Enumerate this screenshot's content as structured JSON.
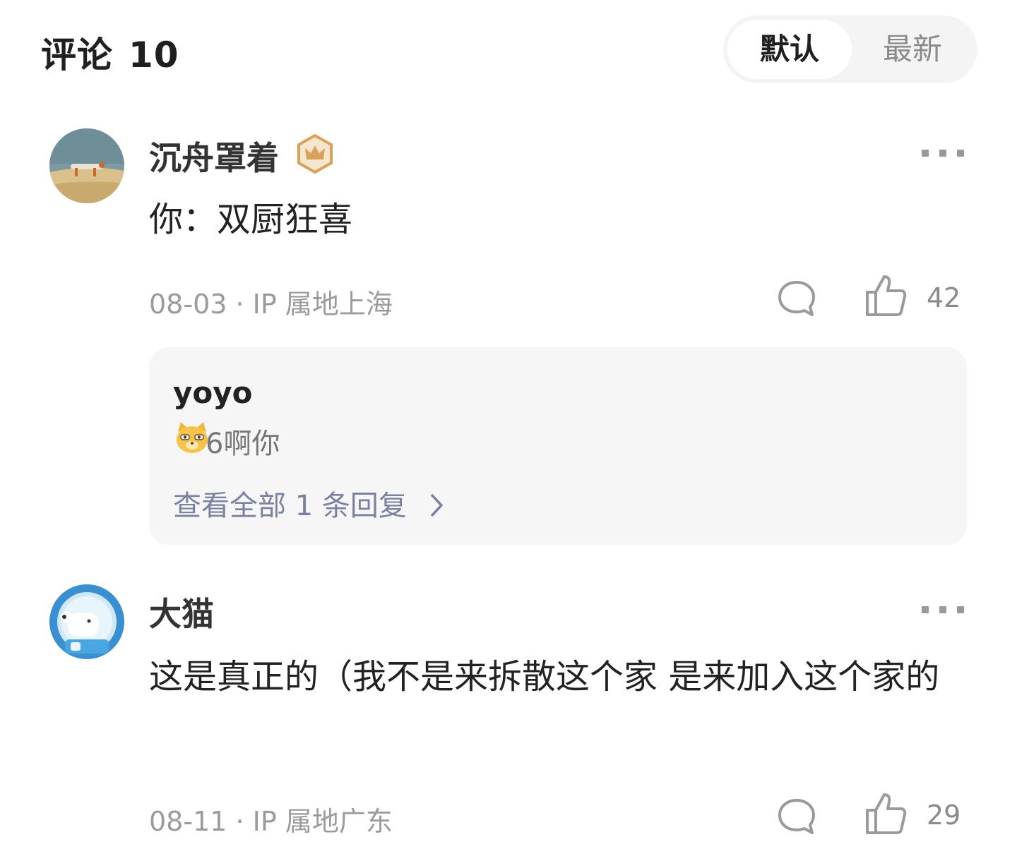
{
  "header": {
    "title": "评论",
    "count": "10",
    "sort_default": "默认",
    "sort_latest": "最新"
  },
  "comments": [
    {
      "username": "沉舟罩着",
      "content": "你：双厨狂喜",
      "date": "08-03",
      "location": "IP 属地上海",
      "likes": "42",
      "reply": {
        "username": "yoyo",
        "text": "6啊你",
        "view_all": "查看全部 1 条回复"
      }
    },
    {
      "username": "大猫",
      "content": "这是真正的（我不是来拆散这个家 是来加入这个家的",
      "date": "08-11",
      "location": "IP 属地广东",
      "likes": "29"
    }
  ],
  "colors": {
    "accent_link": "#7a82a0",
    "meta_gray": "#9b9b9b",
    "badge_gold": "#d9a25a"
  },
  "icons": [
    "crown-badge-icon",
    "more-icon",
    "comment-icon",
    "thumbs-up-icon",
    "chevron-right-icon",
    "cat-emoji-icon"
  ]
}
